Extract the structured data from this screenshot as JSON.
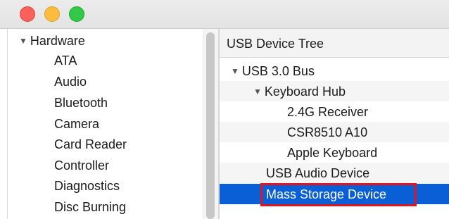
{
  "window": {
    "traffic_lights": {
      "close": "close-button",
      "minimize": "minimize-button",
      "zoom": "zoom-button"
    }
  },
  "sidebar": {
    "header": "Hardware",
    "items": [
      {
        "label": "ATA"
      },
      {
        "label": "Audio"
      },
      {
        "label": "Bluetooth"
      },
      {
        "label": "Camera"
      },
      {
        "label": "Card Reader"
      },
      {
        "label": "Controller"
      },
      {
        "label": "Diagnostics"
      },
      {
        "label": "Disc Burning"
      }
    ]
  },
  "main": {
    "title": "USB Device Tree",
    "tree": [
      {
        "label": "USB 3.0 Bus",
        "expanded": true,
        "level": 0
      },
      {
        "label": "Keyboard Hub",
        "expanded": true,
        "level": 1
      },
      {
        "label": "2.4G Receiver",
        "level": 2
      },
      {
        "label": "CSR8510 A10",
        "level": 2
      },
      {
        "label": "Apple Keyboard",
        "level": 2
      },
      {
        "label": "USB Audio Device",
        "level": 1
      },
      {
        "label": "Mass Storage Device",
        "level": 1,
        "selected": true
      }
    ]
  },
  "colors": {
    "selection": "#0a5fd6",
    "highlight_box": "#e0151e",
    "close": "#fc605c",
    "minimize": "#fdbc40",
    "zoom": "#34c84a"
  }
}
